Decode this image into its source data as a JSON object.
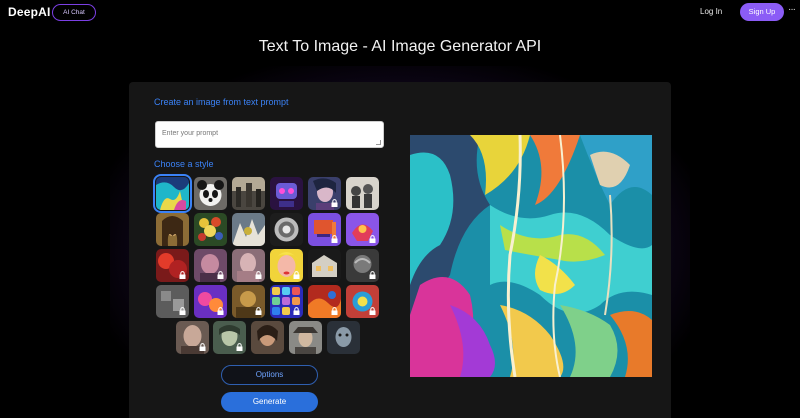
{
  "nav": {
    "logo": "DeepAI",
    "ai_chat_label": "AI Chat",
    "login_label": "Log In",
    "signup_label": "Sign Up",
    "more_icon": "more-dots-icon"
  },
  "page": {
    "title": "Text To Image - AI Image Generator API"
  },
  "generator": {
    "create_heading": "Create an image from text prompt",
    "prompt_placeholder": "Enter your prompt",
    "prompt_value": "",
    "style_heading": "Choose a style",
    "options_label": "Options",
    "generate_label": "Generate"
  },
  "styles": {
    "selected_index": 0,
    "rows": [
      [
        {
          "locked": false
        },
        {
          "locked": false
        },
        {
          "locked": false
        },
        {
          "locked": false
        },
        {
          "locked": true
        },
        {
          "locked": false
        }
      ],
      [
        {
          "locked": false
        },
        {
          "locked": false
        },
        {
          "locked": false
        },
        {
          "locked": false
        },
        {
          "locked": true
        },
        {
          "locked": true
        }
      ],
      [
        {
          "locked": true
        },
        {
          "locked": true
        },
        {
          "locked": true
        },
        {
          "locked": true
        },
        {
          "locked": false
        },
        {
          "locked": true
        }
      ],
      [
        {
          "locked": true
        },
        {
          "locked": true
        },
        {
          "locked": true
        },
        {
          "locked": true
        },
        {
          "locked": true
        },
        {
          "locked": true
        }
      ],
      [
        {
          "locked": true
        },
        {
          "locked": true
        },
        {
          "locked": false
        },
        {
          "locked": false
        },
        {
          "locked": false
        }
      ]
    ]
  },
  "colors": {
    "accent": "#3b82f6",
    "signup": "#8b5cf6",
    "generate": "#2a6fdb",
    "background": "#000000",
    "card": "#161616"
  }
}
